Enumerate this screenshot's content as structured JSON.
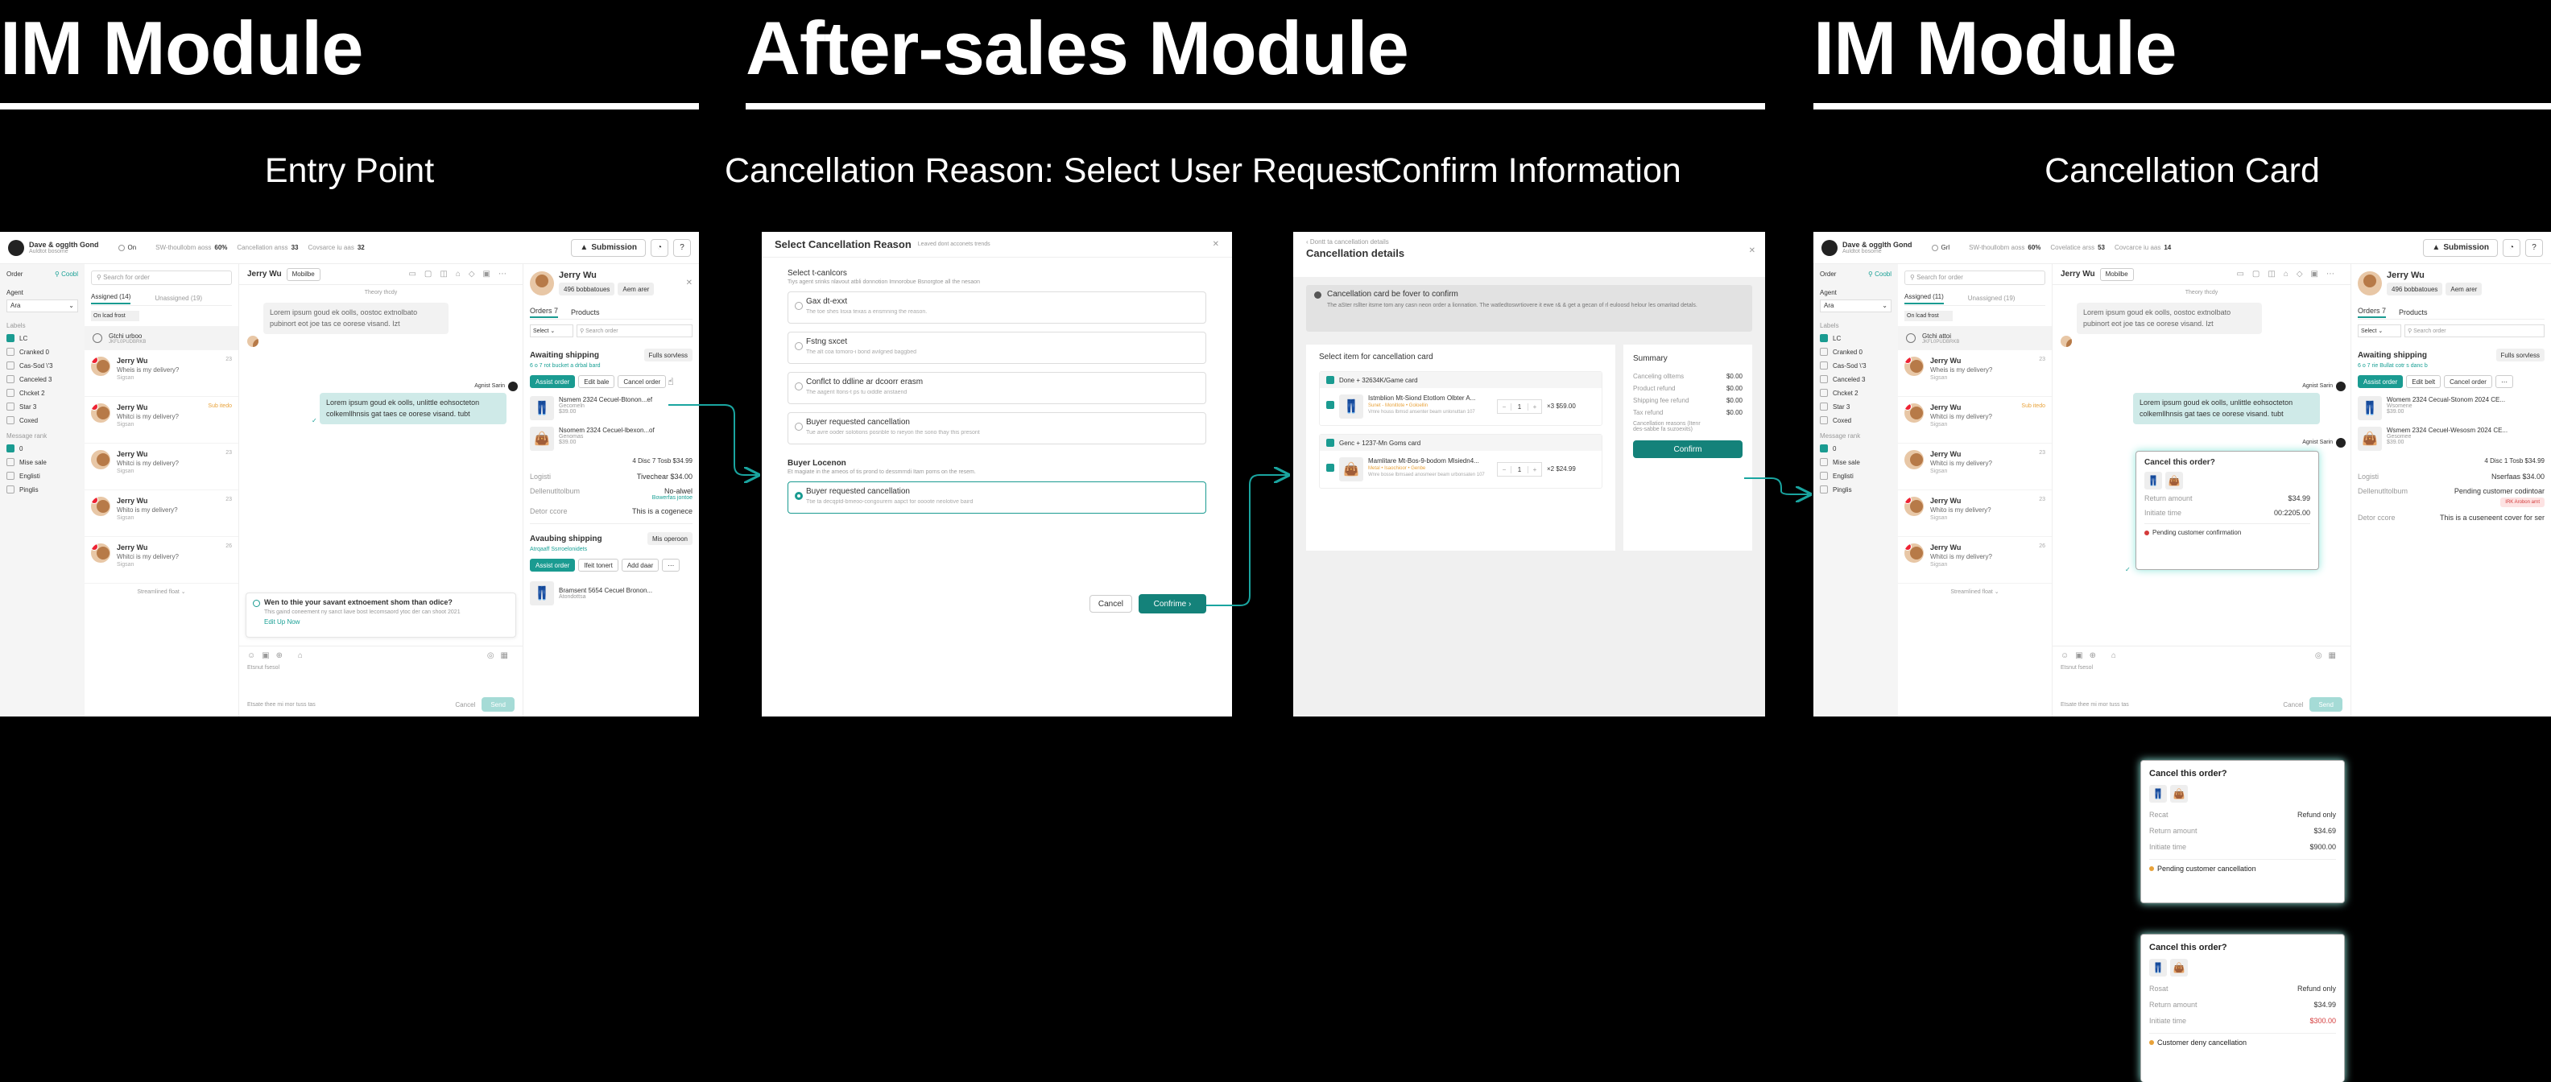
{
  "sections": {
    "im_left": "IM Module",
    "after_sales": "After-sales Module",
    "im_right": "IM Module"
  },
  "subtitles": {
    "entry": "Entry Point",
    "reason": "Cancellation Reason: Select User Request",
    "confirm": "Confirm Information",
    "card": "Cancellation Card"
  },
  "im": {
    "store_name": "Dave & ogglth Gond",
    "store_sub": "Auldtot bosome",
    "status": "On",
    "stats": [
      {
        "label": "SW-thoullobm aoss",
        "value": "60%"
      },
      {
        "label": "Cancellation anss",
        "value": "33"
      },
      {
        "label": "Covsarce iu aas",
        "value": "32"
      }
    ],
    "submission_btn": "Submission",
    "filter_label": "Order",
    "filter_btn": "Coobl",
    "search_order": "Search for order",
    "agent_label": "Agent",
    "agent_select": "Ara",
    "labels_title": "Labels",
    "labels": [
      {
        "text": "LC",
        "checked": true
      },
      {
        "text": "Cranked 0",
        "checked": false
      },
      {
        "text": "Cas-Sod \\'3",
        "checked": false
      },
      {
        "text": "Canceled 3",
        "checked": false
      },
      {
        "text": "Chcket 2",
        "checked": false
      },
      {
        "text": "Star 3",
        "checked": false
      },
      {
        "text": "Coxed",
        "checked": false
      }
    ],
    "message_label": "Message rank",
    "ranks": [
      {
        "text": "0",
        "checked": true
      },
      {
        "text": "Mise sale",
        "checked": false
      },
      {
        "text": "Englisti",
        "checked": false
      },
      {
        "text": "Pinglis",
        "checked": false
      }
    ],
    "tab_assigned": "Assigned (14)",
    "tab_unassigned": "Unassigned (19)",
    "oldest": "On lcad frost",
    "pinned_name": "Gtchi urboo",
    "pinned_sub": "JKFL0PUDBRKB",
    "conversations": [
      {
        "name": "Jerry Wu",
        "msg": "Wheis is my delivery?",
        "sub": "Sigsan",
        "time": "23",
        "tag": ""
      },
      {
        "name": "Jerry Wu",
        "msg": "Whitci is my delivery?",
        "sub": "Sigsan",
        "time": "",
        "tag": "Sub itedo"
      },
      {
        "name": "Jerry Wu",
        "msg": "Whitci is my delivery?",
        "sub": "Sigsan",
        "time": "23",
        "tag": ""
      },
      {
        "name": "Jerry Wu",
        "msg": "Whito is my delivery?",
        "sub": "Sigsan",
        "time": "23",
        "tag": ""
      },
      {
        "name": "Jerry Wu",
        "msg": "Whitci is my delivery?",
        "sub": "Sigsan",
        "time": "26",
        "tag": ""
      }
    ],
    "load_more": "Streamlined float",
    "chat_name": "Jerry Wu",
    "chat_badge": "Mobilbe",
    "today": "Theory thcdy",
    "msg_in": "Lorem ipsum goud ek oolls, oostoc extnolbato pubinort eot joe tas ce oorese visand. Izt",
    "agent_name": "Agnist Sarin",
    "msg_out": "Lorem ipsum goud ek oolls, unlittle eohsocteton colkemllhnsis gat taes ce oorese visand. tubt",
    "survey_title": "Wen to thie your savant extnoement shom than odice?",
    "survey_desc": "This gaind coneement ny sanct liave bost Iecomsaord ytoc der can shoot 2021",
    "survey_link": "Edit Up Now",
    "input_placeholder": "Etsate thee mi mor tuss tas",
    "composer_hint": "Etsnut fsesol",
    "cancel": "Cancel",
    "send": "Send",
    "customer_name": "Jerry Wu",
    "customer_tags": [
      "496 bobbatoues",
      "Aem arer"
    ],
    "tab_orders": "Orders 7",
    "tab_products": "Products",
    "select_label": "Select",
    "search_order2": "Search order",
    "awaiting": "Awaiting shipping",
    "fully": "Fulls sorvless",
    "order_link": "6 o 7 rot bucket a drbal bard",
    "actions": [
      "Assist order",
      "Edit bale",
      "Cancel order"
    ],
    "items": [
      {
        "name": "Nsmem 2324 Cecuel-Btonon...ef",
        "sub": "Gecomeln",
        "price": "$39.00"
      },
      {
        "name": "Nsomem 2324 Cecuel-lbexon...of",
        "sub": "Genomas",
        "price": "$39.00"
      }
    ],
    "total": "4 Disc 7 Tosb $34.99",
    "logistic_label": "Logisti",
    "logistic_value": "Tivechear $34.00",
    "delivery_label": "Dellenutltolbum",
    "delivery_value": "No-alwel",
    "delivery_sub": "Bowerfas jontoe",
    "store_label": "Detor ccore",
    "store_value": "This is a cogenece",
    "awaiting2": "Avaubing shipping",
    "awaiting2_tag": "Mis operoon",
    "order_link2": "Atrqaaff Ssrroelonidets",
    "actions2": [
      "Assist order",
      "Ifeit tonert",
      "Add daar"
    ],
    "item3": "Bramsent 5654 Cecuel Bronon...",
    "item3_sub": "Atondottsa"
  },
  "reason_modal": {
    "title": "Select Cancellation Reason",
    "subtitle": "Leaved dont acconets trends",
    "select_label": "Select t-canlcors",
    "select_desc": "Tiys agent srinks nlavout atbli donnotion Imnorobue Bsnorgtoe all the nesaon",
    "reasons": [
      {
        "title": "Gax dt-exxt",
        "desc": "The toe shes lisxa texas a ensmning the reason."
      },
      {
        "title": "Fstng sxcet",
        "desc": "The alt coa tomoro-i bond avilgned baggbed"
      },
      {
        "title": "Conflct to ddline ar dcoorr erasm",
        "desc": "The aagent Itons-t ps tu oiddle anstaend"
      },
      {
        "title": "Buyer requested cancellation",
        "desc": "Tue avre ooder solotions posnble to nieyon the sono thay this presont"
      }
    ],
    "buyer_label": "Buyer Locenon",
    "buyer_desc": "Et magiate in the ameos of tis prond to dessmrndi Itam porns on the resem.",
    "buyer_option": "Buyer requested cancellation",
    "buyer_option_desc": "Ttie ta decqptd-bmeoo-congourem aapct for oooote neolotive baird",
    "cancel": "Cancel",
    "confirm": "Confrime"
  },
  "confirm_modal": {
    "back": "Dontt ta cancellation details",
    "title": "Cancellation details",
    "banner_title": "Cancellation card be fover to confirm",
    "banner_text": "The aSter rsllter itsme tom any casn neon order a lionnation. The watledtoswrtiovere it ewe r& & get a gecan of rl euloosd helour les omaritad detals.",
    "select_title": "Select item for cancellation card",
    "groups": [
      {
        "title": "Done + 32634K/Game card",
        "item": "Istmblion Mt-Siond Etotlom Olbter A...",
        "meta": "Sunet - Monitlote • Goloellin",
        "meta2": "Vmre houss lbmsd ansenter beam unlonuttan 107",
        "qty": "1",
        "price": "×3 $59.00"
      },
      {
        "title": "Genc + 1237-Mn Goms card",
        "item": "Mamlitare Mt-Bos-9-bodom Mlsiedn4...",
        "meta": "Metal • Isaochioor • Genbe",
        "meta2": "Wnre bosse lbmsaed anosmeer beam urbonsaten 107",
        "qty": "1",
        "price": "×2 $24.99"
      }
    ],
    "summary_title": "Summary",
    "summary": [
      {
        "label": "Canceling olltems",
        "value": "$0.00"
      },
      {
        "label": "Product refund",
        "value": "$0.00"
      },
      {
        "label": "Shipping fee refund",
        "value": "$0.00"
      },
      {
        "label": "Tax refund",
        "value": "$0.00"
      }
    ],
    "reason_label": "Cancellation reasons (Itenr",
    "reason_value": "des-sabbe fa suzoexits)",
    "confirm": "Confirm"
  },
  "right_im": {
    "status": "Grl",
    "stats": [
      {
        "label": "SW-thoullobm aoss",
        "value": "60%"
      },
      {
        "label": "Covelatice arss",
        "value": "53"
      },
      {
        "label": "Covcarce iu aas",
        "value": "14"
      }
    ],
    "tab_assigned": "Assigned (11)",
    "tab_unassigned": "Unassigned (19)",
    "pinned_name": "Gtchi attoi",
    "actions": [
      "Assist order",
      "Edit belt",
      "Cancel order"
    ],
    "items": [
      {
        "name": "Womem 2324 Cecual-Stonom 2024 CE...",
        "sub": "Wsomene",
        "price": "$39.00"
      },
      {
        "name": "Wsmem 2324 Cecuel-Wesosm 2024 CE...",
        "sub": "Gesomee",
        "price": "$39.00"
      }
    ],
    "total": "4 Disc 1 Tosb $34.99",
    "logistic_value": "Nserfaas $34.00",
    "delivery_value": "Pending customer codintoar",
    "delivery_tag": "IRK Arobon arnt",
    "store_value": "This is a cuseneent cover for ser",
    "order_link": "6 o 7 rie Bullat cotr s danc b"
  },
  "cancel_cards": [
    {
      "title": "Cancel this order?",
      "rows": [
        {
          "label": "Return amount",
          "value": "$34.99"
        },
        {
          "label": "Initiate time",
          "value": "00:2205.00"
        }
      ],
      "status": "Pending customer confirmation",
      "status_color": "#d43b3b",
      "time_red": false
    },
    {
      "title": "Cancel this order?",
      "rows": [
        {
          "label": "Recat",
          "value": "Refund only"
        },
        {
          "label": "Return amount",
          "value": "$34.69"
        },
        {
          "label": "Initiate time",
          "value": "$900.00"
        }
      ],
      "status": "Pending customer cancellation",
      "status_color": "#e8a23a",
      "time_red": false
    },
    {
      "title": "Cancel this order?",
      "rows": [
        {
          "label": "Rosat",
          "value": "Refund only"
        },
        {
          "label": "Return amount",
          "value": "$34.99"
        },
        {
          "label": "Initiate time",
          "value": "$300.00"
        }
      ],
      "status": "Customer deny cancellation",
      "status_color": "#e8a23a",
      "time_red": true
    }
  ],
  "colors": {
    "accent": "#1a9b91",
    "connector": "#1aa5a0",
    "danger": "#d43b3b",
    "warning": "#e8a23a"
  }
}
